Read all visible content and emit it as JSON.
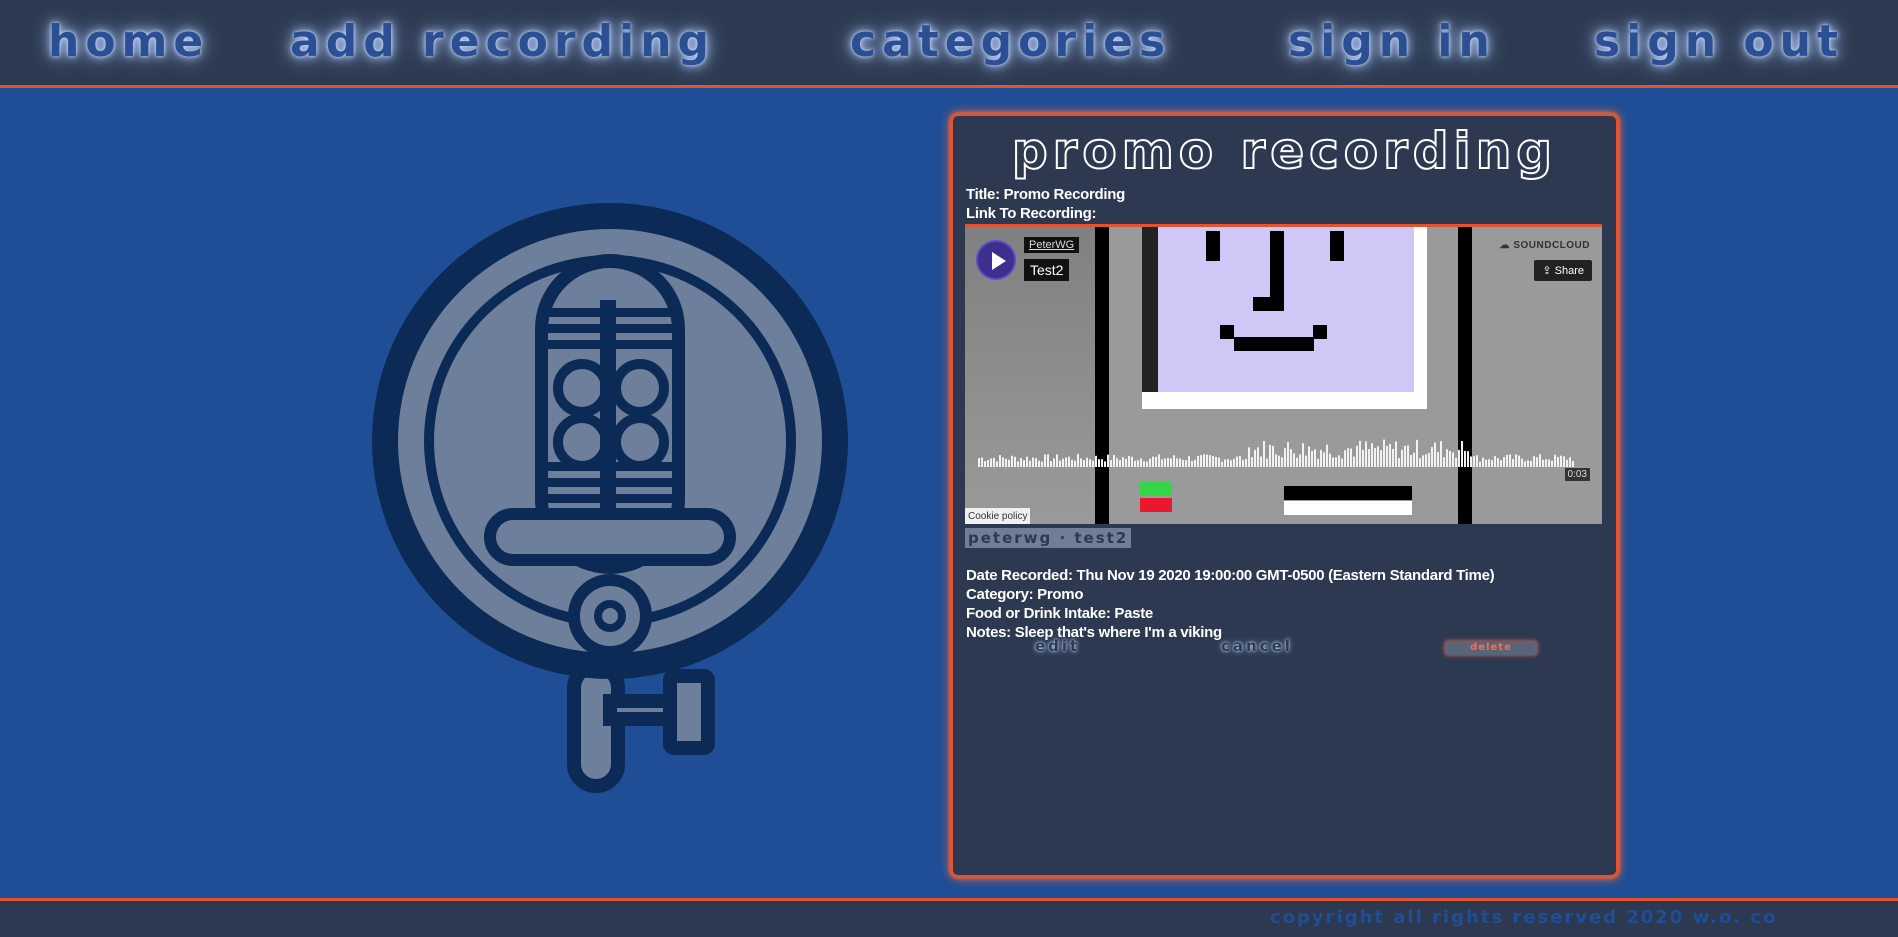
{
  "nav": {
    "items": [
      {
        "label": "Home"
      },
      {
        "label": "Add Recording"
      },
      {
        "label": "Categories"
      },
      {
        "label": "Sign In"
      },
      {
        "label": "Sign Out"
      }
    ]
  },
  "recording": {
    "heading": "Promo Recording",
    "title_line": "Title: Promo Recording",
    "link_label": "Link To Recording:",
    "player": {
      "user": "PeterWG",
      "track": "Test2",
      "brand": "SOUNDCLOUD",
      "share_label": "Share",
      "time": "0:03",
      "cookie_label": "Cookie policy"
    },
    "caption": "PeterWG · Test2",
    "date_line": "Date Recorded: Thu Nov 19 2020 19:00:00 GMT-0500 (Eastern Standard Time)",
    "category_line": "Category: Promo",
    "food_line": "Food or Drink Intake: Paste",
    "notes_line": "Notes: Sleep that's where I'm a viking"
  },
  "actions": {
    "edit_label": "edit",
    "cancel_label": "cancel",
    "delete_label": "delete"
  },
  "footer": {
    "text": "copyright all rights reserved 2020 W.O. Co"
  },
  "colors": {
    "page_bg": "#1f4e96",
    "panel_bg": "#2d3950",
    "accent": "#e2542f",
    "logo": "#6e7f9c"
  },
  "icons": {
    "logo": "microphone-magnifier-logo",
    "play": "play-icon",
    "share": "share-icon",
    "soundcloud": "soundcloud-icon"
  }
}
